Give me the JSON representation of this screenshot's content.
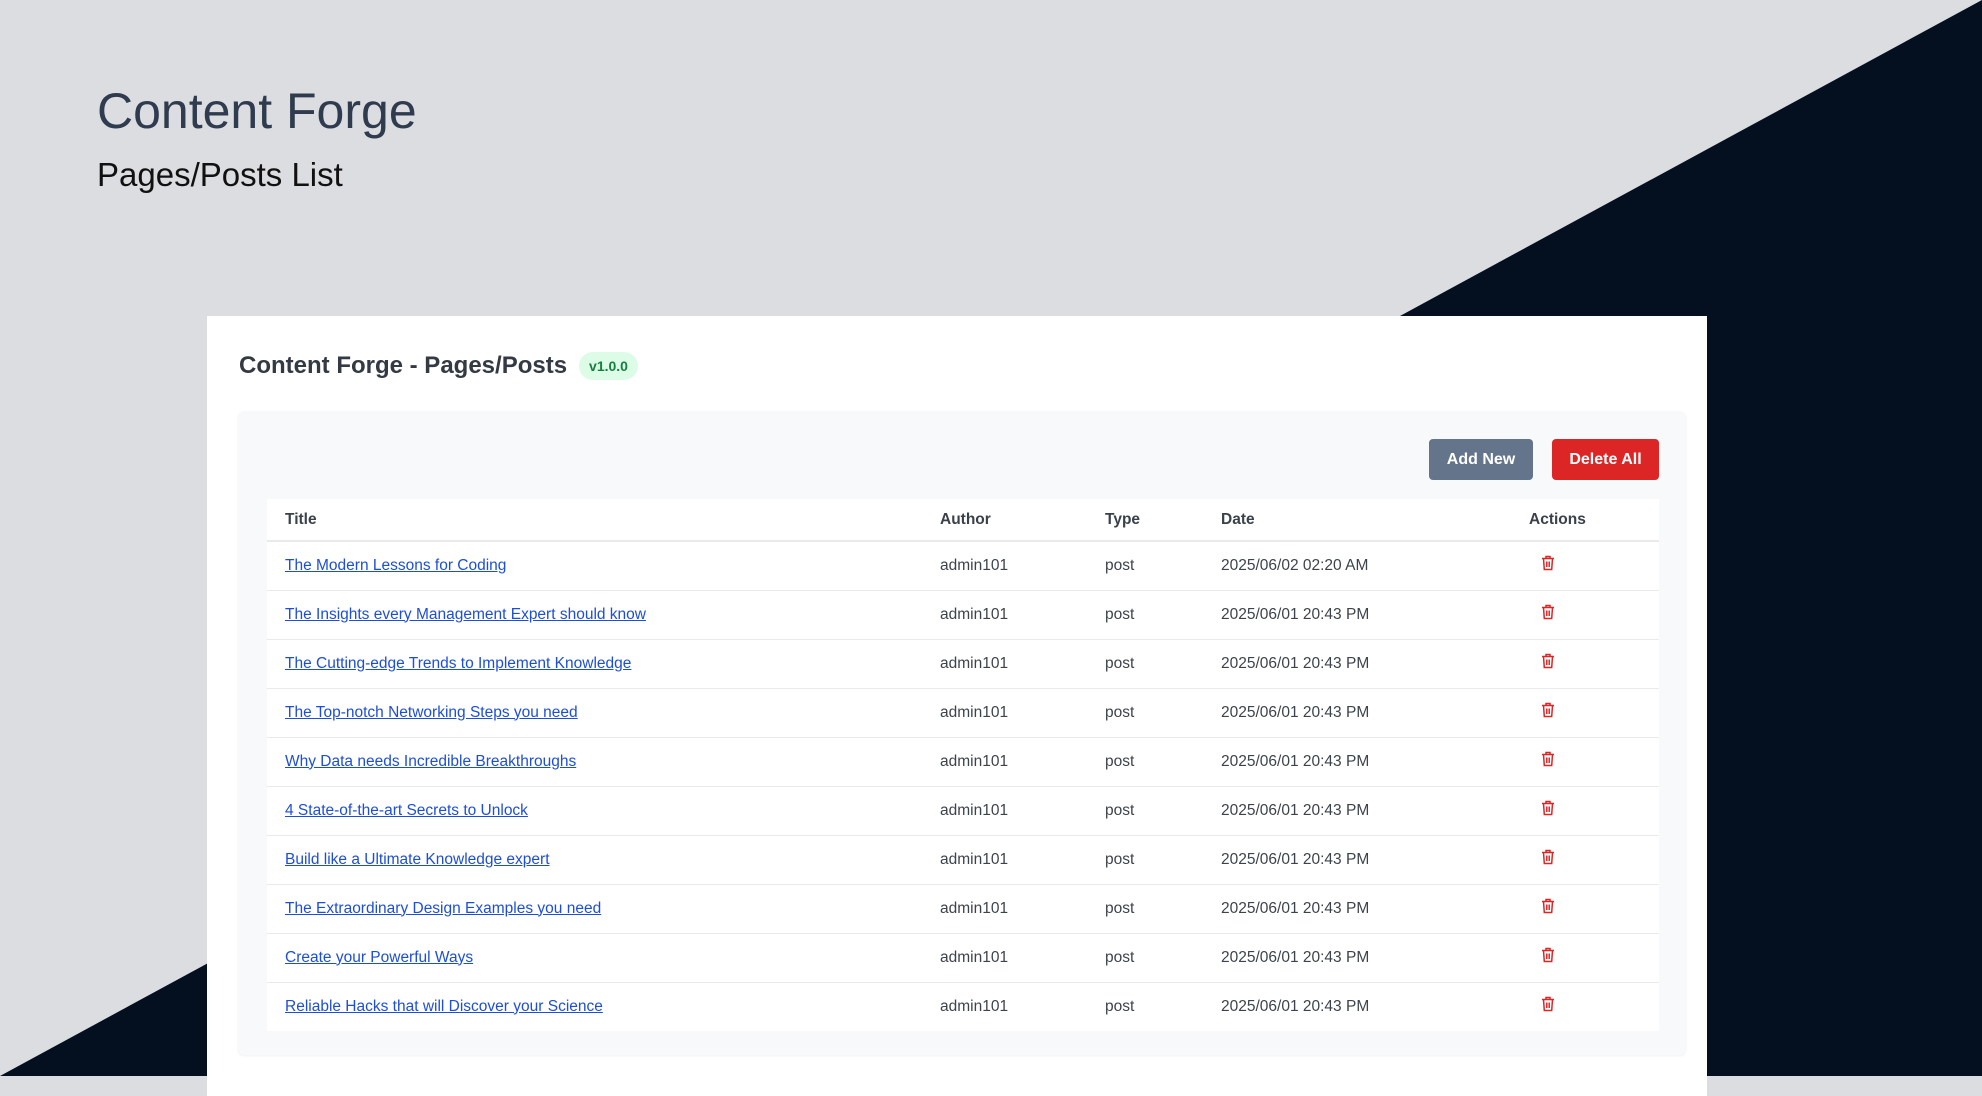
{
  "header": {
    "title": "Content Forge",
    "subtitle": "Pages/Posts List"
  },
  "card": {
    "title": "Content Forge - Pages/Posts",
    "version": "v1.0.0"
  },
  "toolbar": {
    "add_label": "Add New",
    "delete_all_label": "Delete All"
  },
  "table": {
    "columns": [
      "Title",
      "Author",
      "Type",
      "Date",
      "Actions"
    ],
    "rows": [
      {
        "title": "The Modern Lessons for Coding",
        "author": "admin101",
        "type": "post",
        "date": "2025/06/02 02:20 AM"
      },
      {
        "title": "The Insights every Management Expert should know",
        "author": "admin101",
        "type": "post",
        "date": "2025/06/01 20:43 PM"
      },
      {
        "title": "The Cutting-edge Trends to Implement Knowledge",
        "author": "admin101",
        "type": "post",
        "date": "2025/06/01 20:43 PM"
      },
      {
        "title": "The Top-notch Networking Steps you need",
        "author": "admin101",
        "type": "post",
        "date": "2025/06/01 20:43 PM"
      },
      {
        "title": "Why Data needs Incredible Breakthroughs",
        "author": "admin101",
        "type": "post",
        "date": "2025/06/01 20:43 PM"
      },
      {
        "title": "4 State-of-the-art Secrets to Unlock",
        "author": "admin101",
        "type": "post",
        "date": "2025/06/01 20:43 PM"
      },
      {
        "title": "Build like a Ultimate Knowledge expert",
        "author": "admin101",
        "type": "post",
        "date": "2025/06/01 20:43 PM"
      },
      {
        "title": "The Extraordinary Design Examples you need",
        "author": "admin101",
        "type": "post",
        "date": "2025/06/01 20:43 PM"
      },
      {
        "title": "Create your Powerful Ways",
        "author": "admin101",
        "type": "post",
        "date": "2025/06/01 20:43 PM"
      },
      {
        "title": "Reliable Hacks that will Discover your Science",
        "author": "admin101",
        "type": "post",
        "date": "2025/06/01 20:43 PM"
      }
    ]
  },
  "colors": {
    "accent": "#1d4ed8",
    "danger": "#dc2626",
    "secondary": "#64748b",
    "dark": "#04101f"
  }
}
